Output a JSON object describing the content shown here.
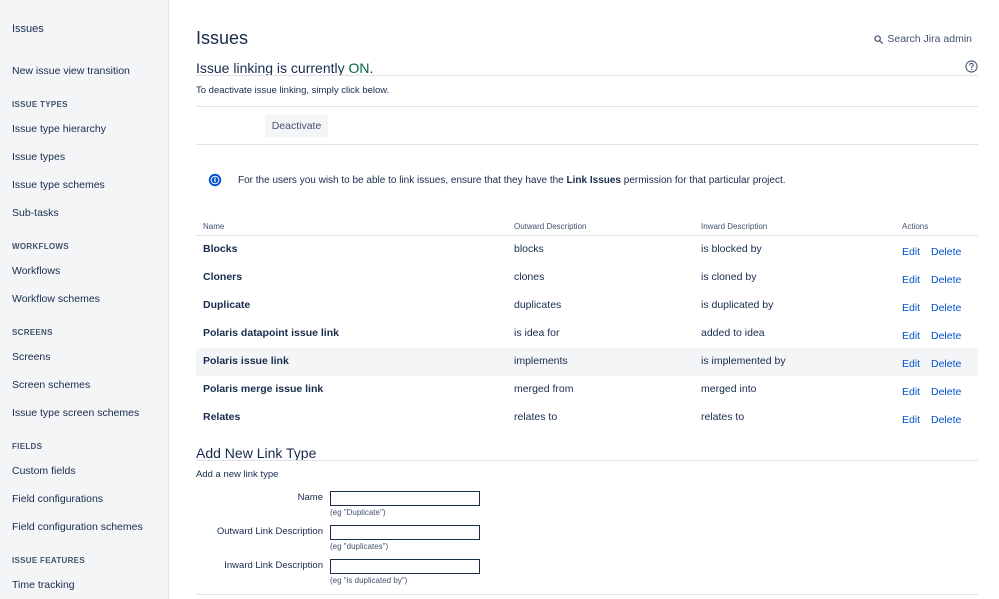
{
  "sidebar": {
    "title": "Issues",
    "top_item": "New issue view transition",
    "sections": [
      {
        "heading": "ISSUE TYPES",
        "items": [
          "Issue type hierarchy",
          "Issue types",
          "Issue type schemes",
          "Sub-tasks"
        ]
      },
      {
        "heading": "WORKFLOWS",
        "items": [
          "Workflows",
          "Workflow schemes"
        ]
      },
      {
        "heading": "SCREENS",
        "items": [
          "Screens",
          "Screen schemes",
          "Issue type screen schemes"
        ]
      },
      {
        "heading": "FIELDS",
        "items": [
          "Custom fields",
          "Field configurations",
          "Field configuration schemes"
        ]
      },
      {
        "heading": "ISSUE FEATURES",
        "items": [
          "Time tracking"
        ]
      }
    ]
  },
  "header": {
    "title": "Issues",
    "search_label": "Search Jira admin"
  },
  "linking": {
    "title_prefix": "Issue linking is currently ",
    "status": "ON",
    "title_suffix": ".",
    "description": "To deactivate issue linking, simply click below.",
    "deactivate_label": "Deactivate"
  },
  "info": {
    "prefix": "For the users you wish to be able to link issues, ensure that they have the ",
    "bold": "Link Issues",
    "suffix": " permission for that particular project."
  },
  "table": {
    "headers": {
      "name": "Name",
      "outward": "Outward Description",
      "inward": "Inward Description",
      "actions": "Actions"
    },
    "edit_label": "Edit",
    "delete_label": "Delete",
    "rows": [
      {
        "name": "Blocks",
        "outward": "blocks",
        "inward": "is blocked by"
      },
      {
        "name": "Cloners",
        "outward": "clones",
        "inward": "is cloned by"
      },
      {
        "name": "Duplicate",
        "outward": "duplicates",
        "inward": "is duplicated by"
      },
      {
        "name": "Polaris datapoint issue link",
        "outward": "is idea for",
        "inward": "added to idea"
      },
      {
        "name": "Polaris issue link",
        "outward": "implements",
        "inward": "is implemented by"
      },
      {
        "name": "Polaris merge issue link",
        "outward": "merged from",
        "inward": "merged into"
      },
      {
        "name": "Relates",
        "outward": "relates to",
        "inward": "relates to"
      }
    ]
  },
  "add_form": {
    "title": "Add New Link Type",
    "description": "Add a new link type",
    "fields": [
      {
        "label": "Name",
        "value": "",
        "hint": "(eg \"Duplicate\")"
      },
      {
        "label": "Outward Link Description",
        "value": "",
        "hint": "(eg \"duplicates\")"
      },
      {
        "label": "Inward Link Description",
        "value": "",
        "hint": "(eg \"is duplicated by\")"
      }
    ]
  }
}
